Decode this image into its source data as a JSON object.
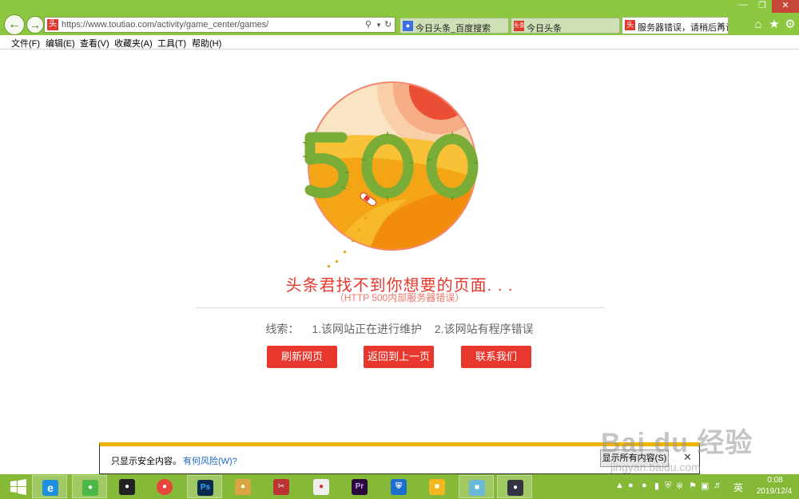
{
  "browser": {
    "url": "https://www.toutiao.com/activity/game_center/games/",
    "site_favicon": "头",
    "tabs": [
      {
        "label": "今日头条_百度搜索",
        "favicon": "baidu-paw-icon",
        "active": false
      },
      {
        "label": "今日头条",
        "favicon": "头条",
        "active": false
      },
      {
        "label": "服务器错误，请稍后再试",
        "favicon": "头",
        "active": true
      }
    ]
  },
  "menu": [
    {
      "label": "文件(F)"
    },
    {
      "label": "编辑(E)"
    },
    {
      "label": "查看(V)"
    },
    {
      "label": "收藏夹(A)"
    },
    {
      "label": "工具(T)"
    },
    {
      "label": "帮助(H)"
    }
  ],
  "page": {
    "error_code": "500",
    "title": "头条君找不到你想要的页面. . .",
    "subtitle": "（HTTP 500内部服务器错误）",
    "clues_label": "线索：",
    "clues": [
      "1.该网站正在进行维护",
      "2.该网站有程序错误"
    ],
    "buttons": {
      "refresh": "刷新网页",
      "back": "返回到上一页",
      "contact": "联系我们"
    },
    "colors": {
      "accent": "#e8372c",
      "sun": "#f8b600",
      "cactus": "#7aad38"
    }
  },
  "notification": {
    "text": "只显示安全内容。",
    "link": "有何风险(W)?",
    "button": "显示所有内容(S)"
  },
  "taskbar": {
    "time": "0:08",
    "date": "2019/12/4",
    "ime": "英"
  },
  "watermark": {
    "brand": "Bai du 经验",
    "sub": "jingyan.baidu.com"
  }
}
